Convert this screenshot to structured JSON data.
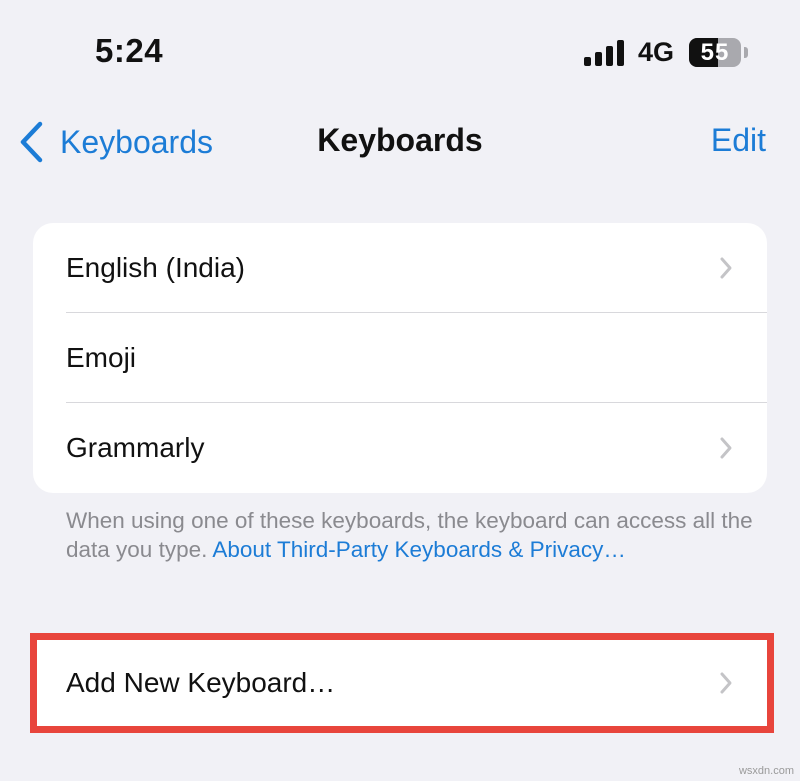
{
  "status_bar": {
    "time": "5:24",
    "network": "4G",
    "battery": "55",
    "battery_level": 0.55
  },
  "nav": {
    "back_label": "Keyboards",
    "title": "Keyboards",
    "edit_label": "Edit"
  },
  "keyboards": [
    {
      "label": "English (India)",
      "has_chevron": true
    },
    {
      "label": "Emoji",
      "has_chevron": false
    },
    {
      "label": "Grammarly",
      "has_chevron": true
    }
  ],
  "note": {
    "text": "When using one of these keyboards, the keyboard can access all the data you type.",
    "link": "About Third-Party Keyboards & Privacy…"
  },
  "add_keyboard": {
    "label": "Add New Keyboard…",
    "highlight_color": "#e8453c"
  },
  "colors": {
    "accent": "#1c7cd6",
    "background": "#f1f1f6",
    "card": "#ffffff"
  },
  "watermark": "wsxdn.com"
}
